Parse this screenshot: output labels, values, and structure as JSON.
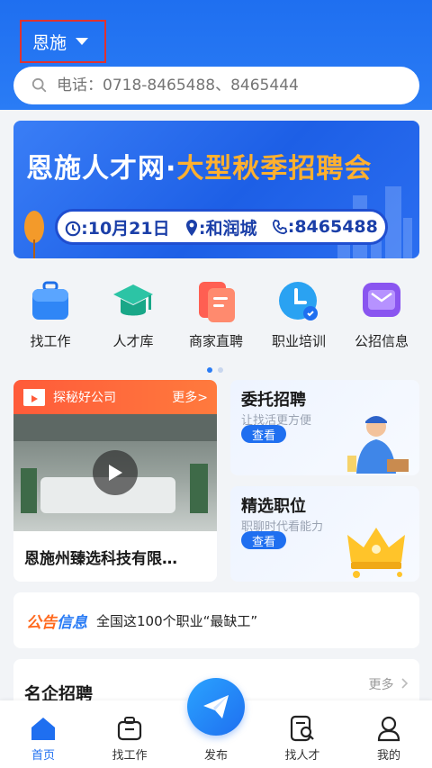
{
  "header": {
    "city": "恩施",
    "search_placeholder": "电话：0718-8465488、8465444"
  },
  "banner": {
    "title_part1": "恩施人才网",
    "title_sep": "·",
    "title_part2": "大型秋季招聘会",
    "date": ":10月21日",
    "place": ":和润城",
    "phone": ":8465488"
  },
  "quick_icons": [
    {
      "label": "找工作",
      "icon": "briefcase-icon"
    },
    {
      "label": "人才库",
      "icon": "graduation-cap-icon"
    },
    {
      "label": "商家直聘",
      "icon": "document-icon"
    },
    {
      "label": "职业培训",
      "icon": "clock-icon"
    },
    {
      "label": "公招信息",
      "icon": "message-icon"
    }
  ],
  "video_card": {
    "tag": "探秘好公司",
    "more": "更多>",
    "company": "恩施州臻选科技有限…"
  },
  "entrust": {
    "title": "委托招聘",
    "subtitle": "让找活更方便",
    "button": "查看"
  },
  "featured": {
    "title": "精选职位",
    "subtitle": "职聊时代看能力",
    "button": "查看"
  },
  "notice": {
    "tag_a": "公告",
    "tag_b": "信息",
    "text": "全国这100个职业“最缺工”"
  },
  "famous": {
    "title": "名企招聘",
    "more": "更多"
  },
  "nav": [
    {
      "label": "首页",
      "icon": "home-icon"
    },
    {
      "label": "找工作",
      "icon": "briefcase-icon"
    },
    {
      "label": "发布",
      "icon": "paper-plane-icon"
    },
    {
      "label": "找人才",
      "icon": "search-resume-icon"
    },
    {
      "label": "我的",
      "icon": "user-icon"
    }
  ],
  "colors": {
    "brand": "#1f6ff0",
    "accent_orange": "#ff6a1f",
    "banner_highlight": "#ffb02e"
  }
}
